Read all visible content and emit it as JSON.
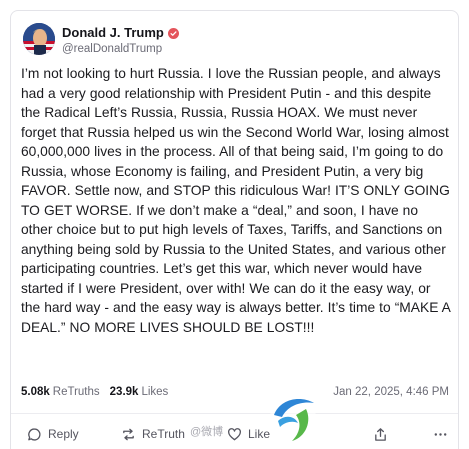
{
  "author": {
    "name": "Donald J. Trump",
    "handle": "@realDonaldTrump",
    "verified_color": "#e4545b"
  },
  "post": {
    "text": "I’m not looking to hurt Russia. I love the Russian people, and always had a very good relationship with President Putin - and this despite the Radical Left’s Russia, Russia, Russia HOAX. We must never forget that Russia helped us win the Second World War, losing almost 60,000,000 lives in the process. All of that being said, I’m going to do Russia, whose Economy is failing, and President Putin, a very big FAVOR. Settle now, and STOP this ridiculous War! IT’S ONLY GOING TO GET WORSE. If we don’t make a “deal,” and soon, I have no other choice but to put high levels of Taxes, Tariffs, and Sanctions on anything being sold by Russia to the United States, and various other participating countries. Let’s get this war, which never would have started if I were President, over with! We can do it the easy way, or the hard way - and the easy way is always better. It’s time to “MAKE A DEAL.” NO MORE LIVES SHOULD BE LOST!!!"
  },
  "stats": {
    "retruths_count": "5.08k",
    "retruths_label": "ReTruths",
    "likes_count": "23.9k",
    "likes_label": "Likes",
    "timestamp": "Jan 22, 2025, 4:46 PM"
  },
  "actions": {
    "reply_label": "Reply",
    "retruth_label": "ReTruth",
    "like_label": "Like"
  },
  "icons": [
    "avatar",
    "verified-badge-icon",
    "reply-icon",
    "retruth-icon",
    "heart-icon",
    "share-icon",
    "more-icon",
    "watermark-logo"
  ],
  "watermark": {
    "text": "@微博"
  }
}
